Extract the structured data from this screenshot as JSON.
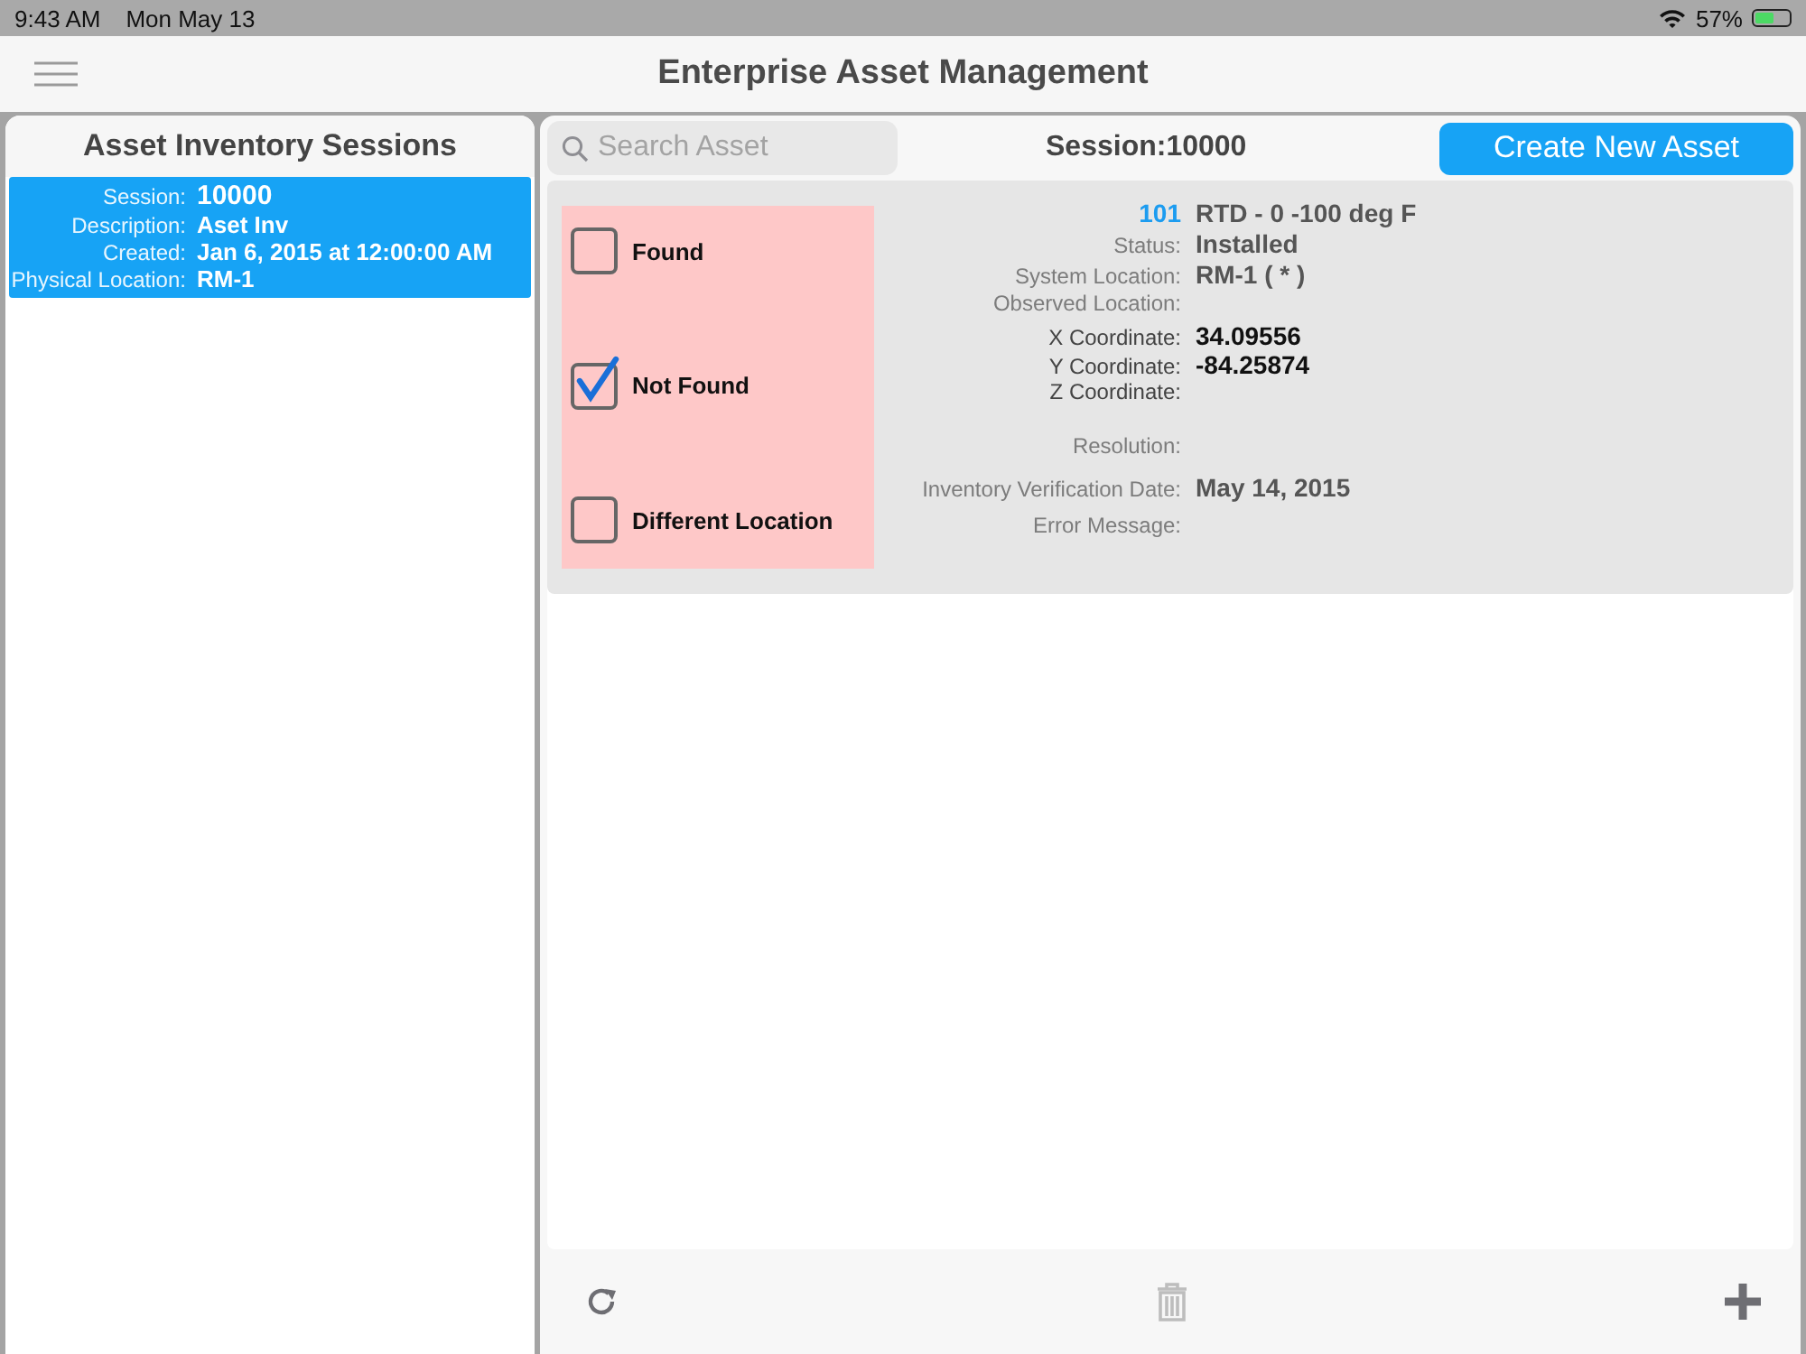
{
  "status_bar": {
    "time": "9:43 AM",
    "date": "Mon May 13",
    "battery": "57%"
  },
  "nav_bar": {
    "title": "Enterprise Asset Management"
  },
  "sidebar": {
    "title": "Asset Inventory Sessions",
    "items": [
      {
        "selected": true,
        "fields": [
          {
            "label": "Session:",
            "value": "10000",
            "kind": "large"
          },
          {
            "label": "Description:",
            "value": "Aset Inv",
            "kind": "normal"
          },
          {
            "label": "Created:",
            "value": "Jan 6, 2015 at 12:00:00 AM",
            "kind": "normal"
          },
          {
            "label": "Physical Location:",
            "value": "RM-1",
            "kind": "normal"
          }
        ]
      }
    ]
  },
  "toolbar": {
    "search": {
      "placeholder": "Search Asset"
    },
    "session_title": "Session:10000",
    "create_button": "Create New Asset"
  },
  "assets": [
    {
      "options": [
        {
          "label": "Found",
          "checked": false
        },
        {
          "label": "Not Found",
          "checked": true
        },
        {
          "label": "Different Location",
          "checked": false
        }
      ],
      "groups": [
        [
          {
            "kind": "heading",
            "label": "101",
            "value": "RTD - 0 -100 deg F"
          },
          {
            "kind": "field",
            "label": "Status:",
            "value": "Installed"
          },
          {
            "kind": "field",
            "label": "System Location:",
            "value": "RM-1 ( * )"
          },
          {
            "kind": "field",
            "label": "Observed Location:"
          },
          {
            "kind": "coordinate",
            "label": "X Coordinate:",
            "value": "34.09556"
          },
          {
            "kind": "coordinate",
            "label": "Y Coordinate:",
            "value": "-84.25874"
          },
          {
            "kind": "coordinate",
            "label": "Z Coordinate:"
          }
        ],
        [
          {
            "kind": "field",
            "label": "Resolution:"
          },
          {
            "kind": "field",
            "label": "Inventory Verification Date:",
            "value": "May 14, 2015"
          },
          {
            "kind": "field",
            "label": "Error Message:"
          }
        ]
      ]
    }
  ],
  "bottom_toolbar": [
    {
      "kind": "refresh",
      "disabled": false
    },
    {
      "kind": "delete",
      "disabled": true
    },
    {
      "kind": "add",
      "disabled": false
    }
  ]
}
